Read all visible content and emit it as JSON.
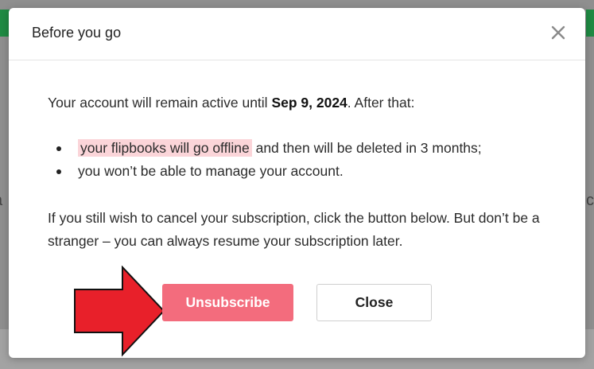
{
  "background": {
    "left_fragment": "a",
    "right_fragment": "c"
  },
  "modal": {
    "title": "Before you go",
    "close_icon": "close-icon",
    "intro_prefix": "Your account will remain active until ",
    "intro_date": "Sep 9, 2024",
    "intro_suffix": ". After that:",
    "bullets": [
      {
        "highlight": "your flipbooks will go offline",
        "rest": " and then will be deleted in 3 months;"
      },
      {
        "highlight": "",
        "rest": "you won’t be able to manage your account."
      }
    ],
    "paragraph": "If you still wish to cancel your subscription, click the button below. But don’t be a stranger – you can always resume your subscription later.",
    "unsubscribe_label": "Unsubscribe",
    "close_label": "Close"
  },
  "colors": {
    "primary_button": "#f36c7d",
    "highlight": "#fbd5d9",
    "annotation_arrow": "#e8202a"
  }
}
